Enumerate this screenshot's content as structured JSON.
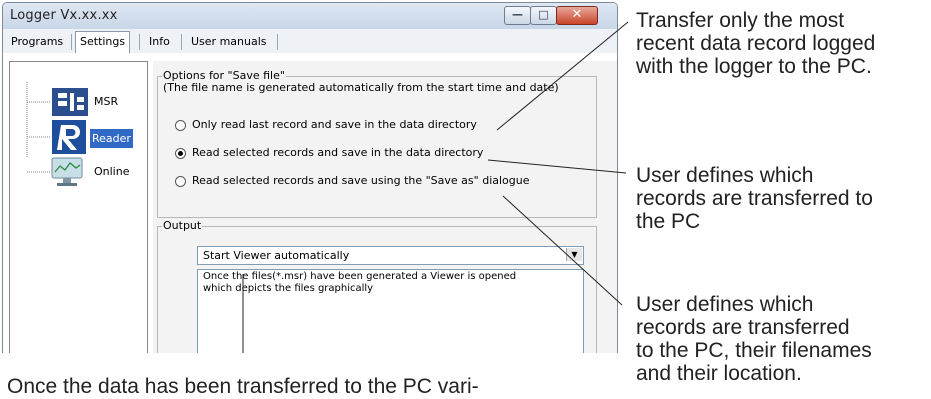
{
  "window": {
    "title": "Logger Vx.xx.xx",
    "controls": {
      "minimize_icon": "minimize-icon",
      "maximize_icon": "maximize-icon",
      "close_icon": "close-icon"
    }
  },
  "tabs": [
    {
      "label": "Programs",
      "active": false
    },
    {
      "label": "Settings",
      "active": true
    },
    {
      "label": "Info",
      "active": false
    },
    {
      "label": "User manuals",
      "active": false
    }
  ],
  "tree": {
    "items": [
      {
        "label": "MSR",
        "icon": "msr-icon",
        "selected": false
      },
      {
        "label": "Reader",
        "icon": "reader-icon",
        "selected": true
      },
      {
        "label": "Online",
        "icon": "online-monitor-icon",
        "selected": false
      }
    ]
  },
  "save_options": {
    "title": "Options for \"Save file\"",
    "note": "(The file name is generated automatically from the  start time and date)",
    "options": [
      {
        "label": "Only read last record and save in the data directory",
        "checked": false
      },
      {
        "label": "Read selected records and save in the data directory",
        "checked": true
      },
      {
        "label": "Read selected records and save using the \"Save as\" dialogue",
        "checked": false
      }
    ]
  },
  "output": {
    "title": "Output",
    "select_value": "Start Viewer automatically",
    "description_lines": [
      "Once the files(*.msr) have been generated a Viewer is opened",
      "which depicts the files graphically"
    ]
  },
  "annotations": {
    "a1": [
      "Transfer only the most",
      "recent data record logged",
      "with the logger to the PC."
    ],
    "a2": [
      "User defines which",
      "records are transferred to",
      "the PC"
    ],
    "a3": [
      "User defines which",
      "records are transferred",
      "to the PC, their filenames",
      "and their location."
    ],
    "caption": "Once the data has been transferred to the PC vari-"
  },
  "colors": {
    "selection": "#316ac5",
    "close_button": "#c8452a"
  }
}
